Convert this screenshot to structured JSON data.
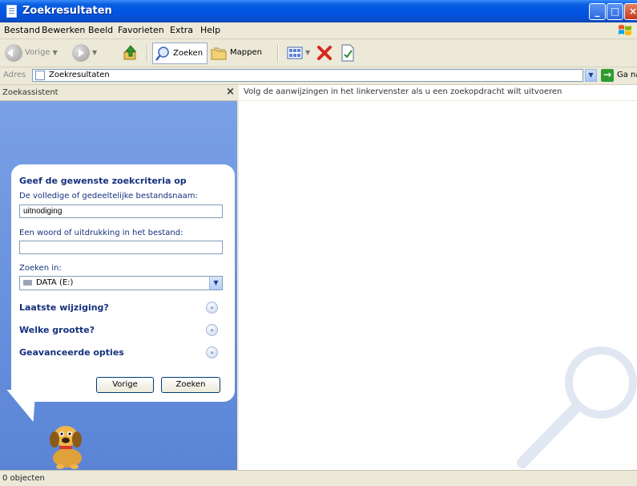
{
  "window": {
    "title": "Zoekresultaten"
  },
  "menu": {
    "items": [
      {
        "label": "Bestand"
      },
      {
        "label": "Bewerken"
      },
      {
        "label": "Beeld"
      },
      {
        "label": "Favorieten"
      },
      {
        "label": "Extra"
      },
      {
        "label": "Help"
      }
    ]
  },
  "toolbar": {
    "back_label": "Vorige",
    "search_label": "Zoeken",
    "folders_label": "Mappen"
  },
  "address": {
    "label": "Adres",
    "value": "Zoekresultaten",
    "go_label": "Ga naar"
  },
  "assistant": {
    "title": "Zoekassistent",
    "close": "×",
    "heading": "Geef de gewenste zoekcriteria op",
    "filename_label": "De volledige of gedeeltelijke bestandsnaam:",
    "filename_value": "uitnodiging",
    "phrase_label": "Een woord of uitdrukking in het bestand:",
    "phrase_value": "",
    "lookin_label": "Zoeken in:",
    "lookin_value": "DATA (E:)",
    "sections": [
      {
        "label": "Laatste wijziging?"
      },
      {
        "label": "Welke grootte?"
      },
      {
        "label": "Geavanceerde opties"
      }
    ],
    "prev_button": "Vorige",
    "search_button": "Zoeken"
  },
  "results": {
    "message": "Volg de aanwijzingen in het linkervenster als u een zoekopdracht wilt uitvoeren"
  },
  "status": {
    "text": "0 objecten"
  }
}
